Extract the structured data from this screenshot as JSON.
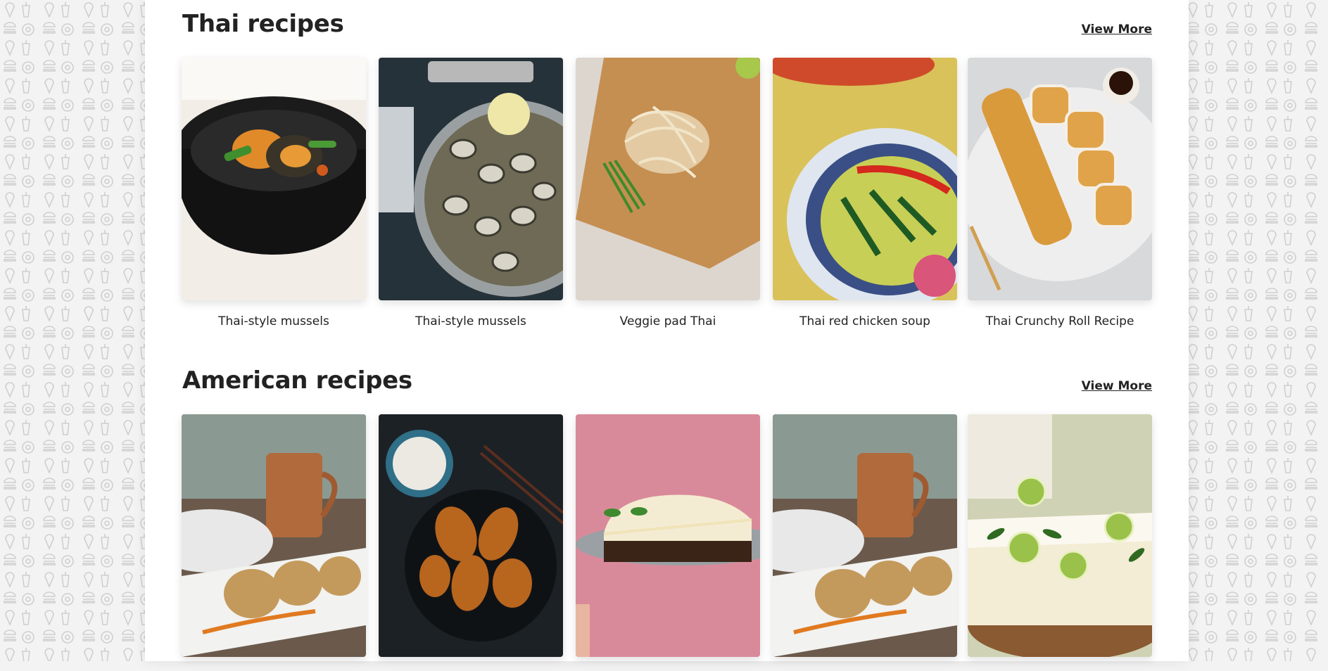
{
  "sections": [
    {
      "title": "Thai recipes",
      "view_more": "View More",
      "cards": [
        {
          "title": "Thai-style mussels",
          "image": "mussels-in-black-pot"
        },
        {
          "title": "Thai-style mussels",
          "image": "clams-in-steel-pan"
        },
        {
          "title": "Veggie pad Thai",
          "image": "pad-thai-on-board"
        },
        {
          "title": "Thai red chicken soup",
          "image": "soup-in-blue-bowl"
        },
        {
          "title": "Thai Crunchy Roll Recipe",
          "image": "sushi-roll-plate"
        }
      ]
    },
    {
      "title": "American recipes",
      "view_more": "View More",
      "cards": [
        {
          "title": "",
          "image": "crab-cakes-copper-mug"
        },
        {
          "title": "",
          "image": "glazed-wings-dark-bowl"
        },
        {
          "title": "",
          "image": "pie-slice-pink-background"
        },
        {
          "title": "",
          "image": "crab-cakes-copper-mug"
        },
        {
          "title": "",
          "image": "lime-bars-wood-board"
        }
      ]
    }
  ],
  "colors": {
    "page_background": "#f3f3f3",
    "content_background": "#ffffff",
    "text": "#222222",
    "pattern_stroke": "#cfcfcf"
  },
  "icons": [
    "ice-cream-icon",
    "cup-icon",
    "fries-icon",
    "burger-icon",
    "taco-icon",
    "hotdog-icon",
    "popsicle-icon",
    "donut-icon"
  ]
}
